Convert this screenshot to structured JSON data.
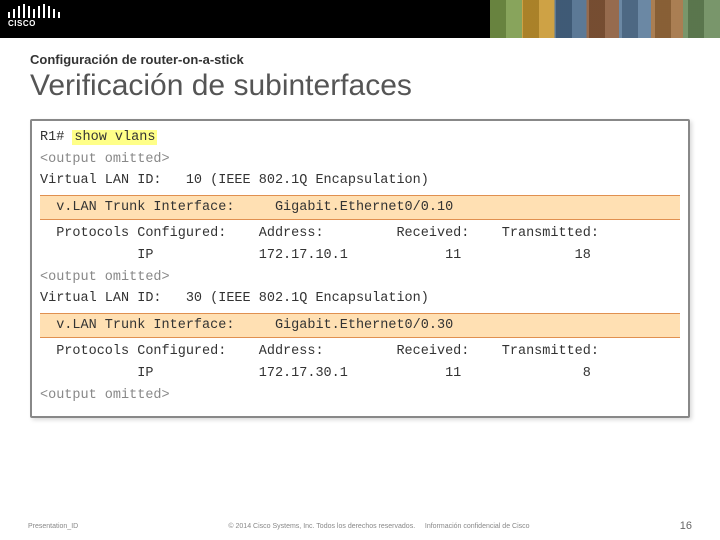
{
  "logo": {
    "text": "CISCO"
  },
  "header": {
    "subtitle": "Configuración de router-on-a-stick",
    "title": "Verificación de subinterfaces"
  },
  "term": {
    "prompt_device": "R1#",
    "prompt_cmd": "show vlans",
    "omit": "<output omitted>",
    "vlan10_id": "Virtual LAN ID:   10 (IEEE 802.1Q Encapsulation)",
    "vlan10_trunk": "  v.LAN Trunk Interface:     Gigabit.Ethernet0/0.10",
    "proto_header": "  Protocols Configured:    Address:         Received:    Transmitted:",
    "vlan10_ip": "            IP             172.17.10.1            11              18",
    "vlan30_id": "Virtual LAN ID:   30 (IEEE 802.1Q Encapsulation)",
    "vlan30_trunk": "  v.LAN Trunk Interface:     Gigabit.Ethernet0/0.30",
    "vlan30_ip": "            IP             172.17.30.1            11               8"
  },
  "footer": {
    "left": "Presentation_ID",
    "mid": "© 2014 Cisco Systems, Inc. Todos los derechos reservados.",
    "right": "Información confidencial de Cisco",
    "page": "16"
  }
}
